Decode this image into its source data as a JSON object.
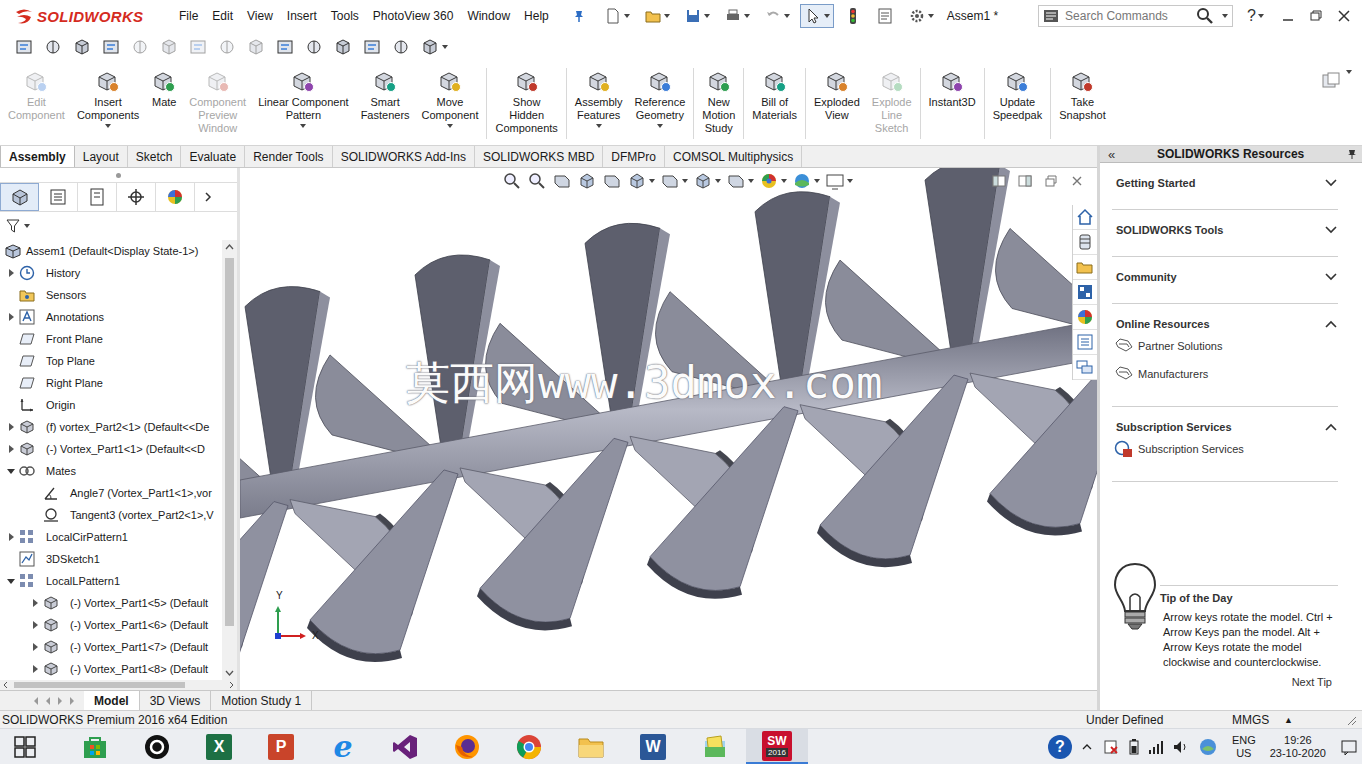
{
  "app": {
    "logo_text": "SOLIDWORKS",
    "document_title": "Assem1 *"
  },
  "menu": [
    "File",
    "Edit",
    "View",
    "Insert",
    "Tools",
    "PhotoView 360",
    "Window",
    "Help"
  ],
  "search": {
    "placeholder": "Search Commands"
  },
  "help": {
    "label": "?"
  },
  "ribbon": {
    "groups": [
      {
        "buttons": [
          {
            "lines": [
              "Edit",
              "Component"
            ],
            "disabled": true,
            "menu": false
          },
          {
            "lines": [
              "Insert",
              "Components"
            ],
            "disabled": false,
            "menu": true
          },
          {
            "lines": [
              "Mate"
            ],
            "disabled": false,
            "menu": false
          },
          {
            "lines": [
              "Component",
              "Preview",
              "Window"
            ],
            "disabled": true,
            "menu": false
          },
          {
            "lines": [
              "Linear Component",
              "Pattern"
            ],
            "disabled": false,
            "menu": true
          },
          {
            "lines": [
              "Smart",
              "Fasteners"
            ],
            "disabled": false,
            "menu": false
          },
          {
            "lines": [
              "Move",
              "Component"
            ],
            "disabled": false,
            "menu": true
          }
        ]
      },
      {
        "buttons": [
          {
            "lines": [
              "Show",
              "Hidden",
              "Components"
            ],
            "disabled": false,
            "menu": false
          }
        ]
      },
      {
        "buttons": [
          {
            "lines": [
              "Assembly",
              "Features"
            ],
            "disabled": false,
            "menu": true
          },
          {
            "lines": [
              "Reference",
              "Geometry"
            ],
            "disabled": false,
            "menu": true
          }
        ]
      },
      {
        "buttons": [
          {
            "lines": [
              "New",
              "Motion",
              "Study"
            ],
            "disabled": false,
            "menu": false
          }
        ]
      },
      {
        "buttons": [
          {
            "lines": [
              "Bill of",
              "Materials"
            ],
            "disabled": false,
            "menu": false
          }
        ]
      },
      {
        "buttons": [
          {
            "lines": [
              "Exploded",
              "View"
            ],
            "disabled": false,
            "menu": false
          },
          {
            "lines": [
              "Explode",
              "Line",
              "Sketch"
            ],
            "disabled": true,
            "menu": false
          }
        ]
      },
      {
        "buttons": [
          {
            "lines": [
              "Instant3D"
            ],
            "disabled": false,
            "menu": false
          }
        ]
      },
      {
        "buttons": [
          {
            "lines": [
              "Update",
              "Speedpak"
            ],
            "disabled": false,
            "menu": false
          }
        ]
      },
      {
        "buttons": [
          {
            "lines": [
              "Take",
              "Snapshot"
            ],
            "disabled": false,
            "menu": false
          }
        ]
      }
    ]
  },
  "tabs": [
    {
      "label": "Assembly",
      "selected": true
    },
    {
      "label": "Layout",
      "selected": false
    },
    {
      "label": "Sketch",
      "selected": false
    },
    {
      "label": "Evaluate",
      "selected": false
    },
    {
      "label": "Render Tools",
      "selected": false
    },
    {
      "label": "SOLIDWORKS Add-Ins",
      "selected": false
    },
    {
      "label": "SOLIDWORKS MBD",
      "selected": false
    },
    {
      "label": "DFMPro",
      "selected": false
    },
    {
      "label": "COMSOL Multiphysics",
      "selected": false
    }
  ],
  "panel_tabs": [
    {
      "selected": true
    },
    {
      "selected": false
    },
    {
      "selected": false
    },
    {
      "selected": false
    },
    {
      "selected": false
    }
  ],
  "feature_tree": {
    "root": "Assem1 (Default<Display State-1>)",
    "items": [
      {
        "label": "History",
        "kind": "history",
        "expandable": true,
        "expanded": false
      },
      {
        "label": "Sensors",
        "kind": "sensors",
        "expandable": false,
        "expanded": false
      },
      {
        "label": "Annotations",
        "kind": "annotations",
        "expandable": true,
        "expanded": false
      },
      {
        "label": "Front Plane",
        "kind": "plane",
        "expandable": false,
        "expanded": false
      },
      {
        "label": "Top Plane",
        "kind": "plane",
        "expandable": false,
        "expanded": false
      },
      {
        "label": "Right Plane",
        "kind": "plane",
        "expandable": false,
        "expanded": false
      },
      {
        "label": "Origin",
        "kind": "origin",
        "expandable": false,
        "expanded": false
      },
      {
        "label": "(f) vortex_Part2<1> (Default<<De",
        "kind": "part",
        "expandable": true,
        "expanded": false
      },
      {
        "label": "(-) Vortex_Part1<1> (Default<<D",
        "kind": "part",
        "expandable": true,
        "expanded": false
      },
      {
        "label": "Mates",
        "kind": "mates",
        "expandable": true,
        "expanded": true,
        "children": [
          {
            "label": "Angle7 (Vortex_Part1<1>,vor",
            "kind": "angle-mate",
            "expandable": false,
            "expanded": false
          },
          {
            "label": "Tangent3 (vortex_Part2<1>,V",
            "kind": "tangent-mate",
            "expandable": false,
            "expanded": false
          }
        ]
      },
      {
        "label": "LocalCirPattern1",
        "kind": "pattern",
        "expandable": true,
        "expanded": false
      },
      {
        "label": "3DSketch1",
        "kind": "sketch",
        "expandable": false,
        "expanded": false
      },
      {
        "label": "LocalLPattern1",
        "kind": "pattern",
        "expandable": true,
        "expanded": true,
        "children": [
          {
            "label": "(-) Vortex_Part1<5> (Default",
            "kind": "part",
            "expandable": true,
            "expanded": false
          },
          {
            "label": "(-) Vortex_Part1<6> (Default",
            "kind": "part",
            "expandable": true,
            "expanded": false
          },
          {
            "label": "(-) Vortex_Part1<7> (Default",
            "kind": "part",
            "expandable": true,
            "expanded": false
          },
          {
            "label": "(-) Vortex_Part1<8> (Default",
            "kind": "part",
            "expandable": true,
            "expanded": false
          }
        ]
      }
    ]
  },
  "viewport": {
    "watermark": "莫西网www.3dmox.com",
    "triad": {
      "y_label": "Y",
      "x_label": "X"
    }
  },
  "task_pane": {
    "collapse": "«",
    "title": "SOLIDWORKS Resources",
    "sections": [
      {
        "title": "Getting Started",
        "expanded": false,
        "items": []
      },
      {
        "title": "SOLIDWORKS Tools",
        "expanded": false,
        "items": []
      },
      {
        "title": "Community",
        "expanded": false,
        "items": []
      },
      {
        "title": "Online Resources",
        "expanded": true,
        "items": [
          {
            "label": "Partner Solutions",
            "kind": "link"
          },
          {
            "label": "Manufacturers",
            "kind": "link"
          }
        ]
      },
      {
        "title": "Subscription Services",
        "expanded": true,
        "items": [
          {
            "label": "Subscription Services",
            "kind": "subscription"
          }
        ]
      }
    ],
    "tip": {
      "title": "Tip of the Day",
      "text": "Arrow keys rotate the model. Ctrl + Arrow Keys pan the model. Alt + Arrow Keys rotate the model clockwise and counterclockwise.",
      "next": "Next Tip"
    }
  },
  "bottom_tabs": [
    {
      "label": "Model",
      "selected": true
    },
    {
      "label": "3D Views",
      "selected": false
    },
    {
      "label": "Motion Study 1",
      "selected": false
    }
  ],
  "status_bar": {
    "edition": "SOLIDWORKS Premium 2016 x64 Edition",
    "state": "Under Defined",
    "units": "MMGS",
    "units_menu": "▲"
  },
  "taskbar": {
    "apps": [
      {
        "kind": "start",
        "active": false
      },
      {
        "kind": "store",
        "active": false
      },
      {
        "kind": "camera",
        "active": false
      },
      {
        "kind": "excel",
        "letter": "X",
        "active": false
      },
      {
        "kind": "powerpoint",
        "letter": "P",
        "active": false
      },
      {
        "kind": "ie",
        "letter": "e",
        "active": false
      },
      {
        "kind": "vs",
        "active": false
      },
      {
        "kind": "firefox",
        "active": false
      },
      {
        "kind": "chrome",
        "active": false
      },
      {
        "kind": "explorer",
        "active": false
      },
      {
        "kind": "word",
        "letter": "W",
        "active": false
      },
      {
        "kind": "docs",
        "active": false
      },
      {
        "kind": "solidworks",
        "letter": "SW",
        "badge": "2016",
        "active": true
      }
    ],
    "tray": {
      "help": "?",
      "language": "ENG",
      "region": "US",
      "time": "19:26",
      "date": "23-10-2020"
    }
  }
}
